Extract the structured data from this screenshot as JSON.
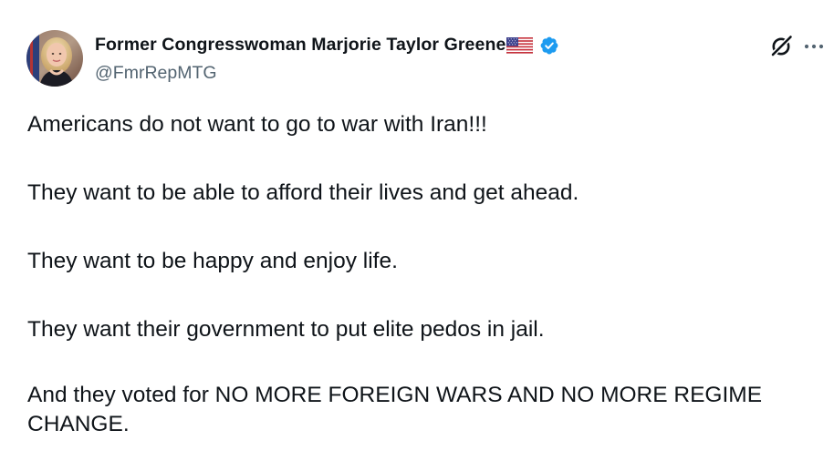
{
  "author": {
    "display_name": "Former Congresswoman Marjorie Taylor Greene",
    "handle": "@FmrRepMTG",
    "avatar": "profile-photo",
    "flag": "us-flag-emoji",
    "verified": "verified-badge-icon"
  },
  "actions": {
    "grok": "grok-icon",
    "more": "more-options-icon"
  },
  "tweet": {
    "paragraphs": [
      "Americans do not want to go to war with Iran!!!",
      "They want to be able to afford their lives and get ahead.",
      "They want to be happy and enjoy life.",
      "They want their government to put elite pedos in jail.",
      "And they voted for NO MORE FOREIGN WARS AND NO MORE REGIME CHANGE."
    ]
  },
  "colors": {
    "text": "#0f1419",
    "secondary": "#536471",
    "verified": "#1d9bf0"
  }
}
